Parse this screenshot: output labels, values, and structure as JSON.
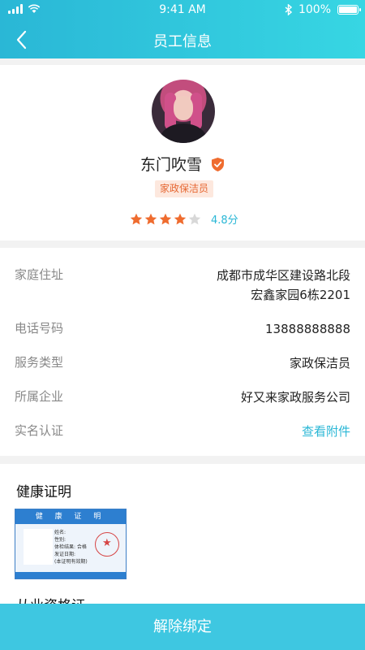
{
  "status_bar": {
    "time": "9:41 AM",
    "battery": "100%"
  },
  "header": {
    "title": "员工信息"
  },
  "profile": {
    "name": "东门吹雪",
    "role": "家政保洁员",
    "rating_stars": 4,
    "rating_max": 5,
    "score": "4.8分"
  },
  "info": {
    "address_label": "家庭住址",
    "address_line1": "成都市成华区建设路北段",
    "address_line2": "宏鑫家园6栋2201",
    "phone_label": "电话号码",
    "phone": "13888888888",
    "service_label": "服务类型",
    "service": "家政保洁员",
    "company_label": "所属企业",
    "company": "好又来家政服务公司",
    "realname_label": "实名认证",
    "realname_link": "查看附件"
  },
  "health": {
    "title": "健康证明",
    "card_title": "健 康 证 明",
    "card_lines": [
      "姓名:",
      "性别:",
      "体检结果: 合格",
      "发证日期:",
      "(本证明有效期)"
    ]
  },
  "qualification": {
    "title": "从业资格证"
  },
  "footer": {
    "unbind_label": "解除绑定"
  },
  "colors": {
    "accent": "#2ab7d6",
    "badge_bg": "#fde8de",
    "badge_text": "#e66833",
    "star": "#ef6c2f"
  }
}
